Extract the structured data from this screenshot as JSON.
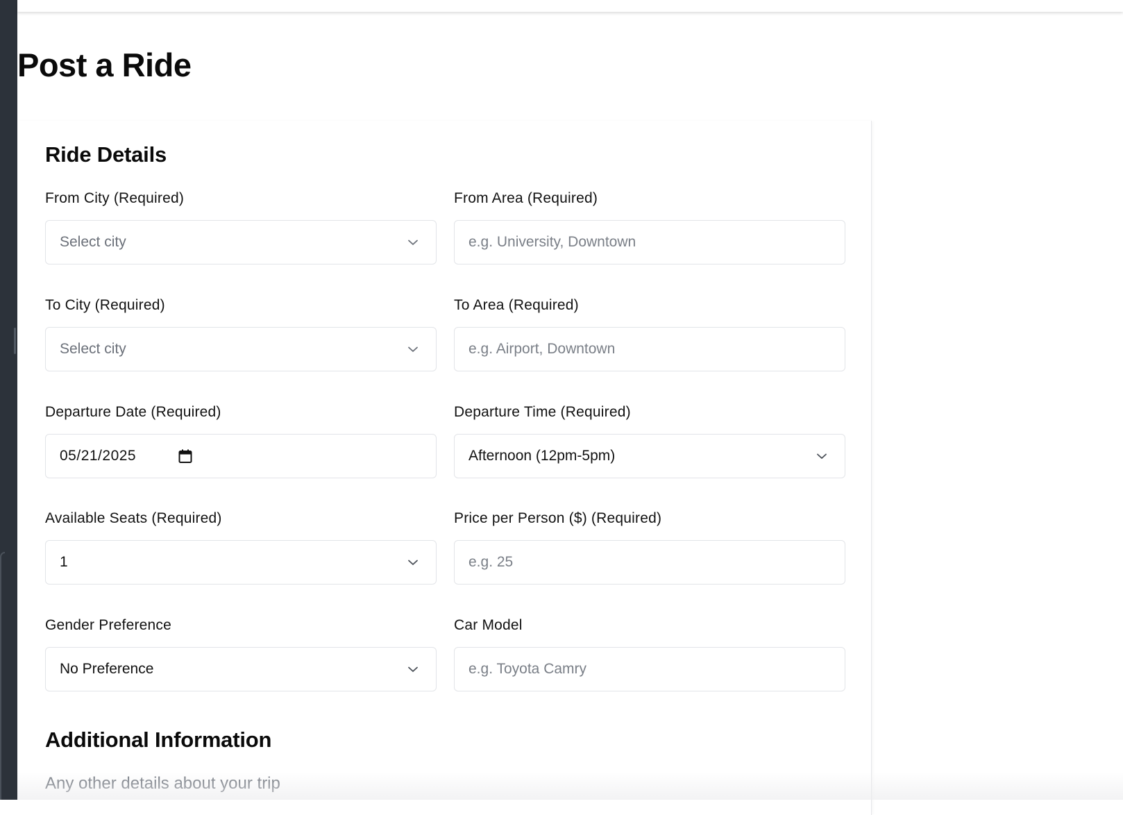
{
  "page": {
    "title": "Post a Ride"
  },
  "sections": {
    "ride_details": "Ride Details",
    "additional_info": "Additional Information"
  },
  "fields": {
    "from_city": {
      "label": "From City (Required)",
      "value": "Select city",
      "type": "select"
    },
    "from_area": {
      "label": "From Area (Required)",
      "placeholder": "e.g. University, Downtown",
      "value": "",
      "type": "text"
    },
    "to_city": {
      "label": "To City (Required)",
      "value": "Select city",
      "type": "select"
    },
    "to_area": {
      "label": "To Area (Required)",
      "placeholder": "e.g. Airport, Downtown",
      "value": "",
      "type": "text"
    },
    "departure_date": {
      "label": "Departure Date (Required)",
      "value": "05/21/2025",
      "type": "date"
    },
    "departure_time": {
      "label": "Departure Time (Required)",
      "value": "Afternoon (12pm-5pm)",
      "type": "select"
    },
    "available_seats": {
      "label": "Available Seats (Required)",
      "value": "1",
      "type": "select"
    },
    "price_per_person": {
      "label": "Price per Person ($) (Required)",
      "placeholder": "e.g. 25",
      "value": "",
      "type": "number"
    },
    "gender_preference": {
      "label": "Gender Preference",
      "value": "No Preference",
      "type": "select"
    },
    "car_model": {
      "label": "Car Model",
      "placeholder": "e.g. Toyota Camry",
      "value": "",
      "type": "text"
    },
    "additional_details": {
      "placeholder": "Any other details about your trip",
      "value": "",
      "type": "textarea"
    }
  },
  "icons": {
    "select_chevron": "chevron-down-icon",
    "date_picker": "calendar-icon"
  },
  "colors": {
    "sidebar": "#2c323a",
    "border": "#e2e4e8",
    "placeholder_text": "#7a7f87",
    "heading_text": "#0a0a0a"
  }
}
